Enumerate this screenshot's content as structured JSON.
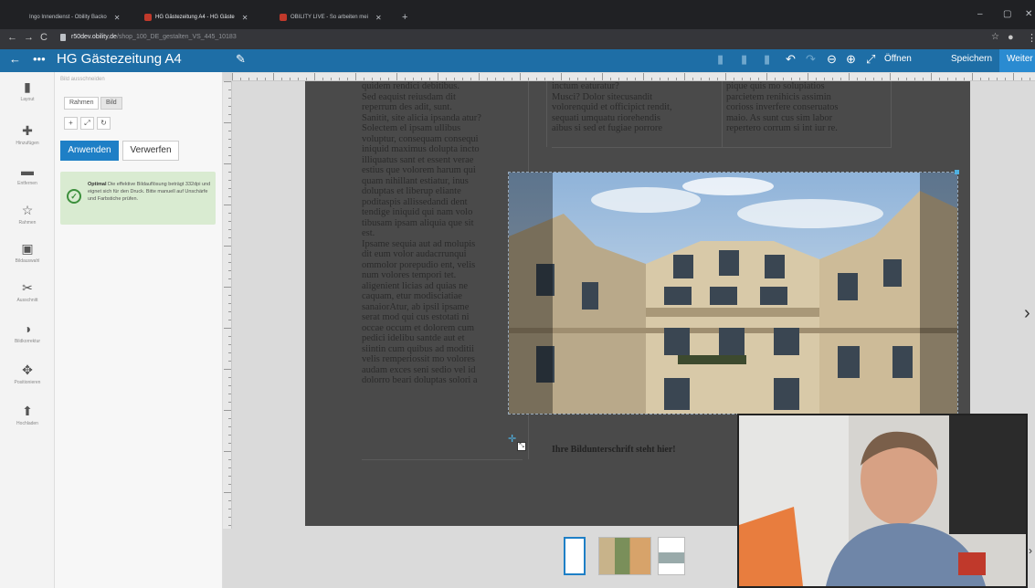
{
  "browser": {
    "tabs": [
      {
        "title": "Ingo Innendienst - Obility Backo",
        "active": false
      },
      {
        "title": "HG Gästezeitung A4 - HG Gäste",
        "active": true
      },
      {
        "title": "OBILITY LIVE - So arbeiten mei",
        "active": false
      }
    ],
    "url_host": "r50dev.obility.de",
    "url_path": "/shop_100_DE_gestalten_VS_445_10183"
  },
  "app": {
    "title": "HG Gästezeitung A4",
    "open_label": "Öffnen",
    "save_label": "Speichern",
    "next_label": "Weiter"
  },
  "tools": [
    {
      "label": "Layout",
      "icon": "file-icon",
      "glyph": "▮"
    },
    {
      "label": "Hinzufügen",
      "icon": "plus-icon",
      "glyph": "✚"
    },
    {
      "label": "Entfernen",
      "icon": "minus-icon",
      "glyph": "▬"
    },
    {
      "label": "Rahmen",
      "icon": "star-icon",
      "glyph": "☆"
    },
    {
      "label": "Bildauswahl",
      "icon": "image-icon",
      "glyph": "▣"
    },
    {
      "label": "Ausschnitt",
      "icon": "crop-icon",
      "glyph": "✂"
    },
    {
      "label": "Bildkorrektur",
      "icon": "contrast-icon",
      "glyph": "◑"
    },
    {
      "label": "Positionieren",
      "icon": "move-icon",
      "glyph": "✥"
    },
    {
      "label": "Hochladen",
      "icon": "upload-icon",
      "glyph": "⬆"
    }
  ],
  "panel": {
    "header": "Bild ausschneiden",
    "tab_frame": "Rahmen",
    "tab_image": "Bild",
    "btn_zoom_in": "+",
    "btn_fit": "⤢",
    "btn_reset": "↻",
    "apply_label": "Anwenden",
    "discard_label": "Verwerfen",
    "info_bold": "Optimal",
    "info_text": " Die effektive Bildauflösung beträgt 332dpi und eignet sich für den Druck. Bitte manuell auf Unschärfe und Farbstiche prüfen."
  },
  "document": {
    "col1_lines": [
      "quidem rendici debitibus.",
      "Sed eaquist reiusdam dit",
      "reperrum des adit, sunt.",
      "Sanitit, site alicia ipsanda atur?",
      "Solectem el ipsam ullibus",
      "voluptur, consequam consequi",
      "iniquid maximus dolupta incto",
      "illiquatus sant et essent verae",
      "estius que volorem harum qui",
      "quam nihillant estiatur, inus",
      "doluptas et liberup eliante",
      "poditaspis allissedandi dent",
      "tendige iniquid qui nam volo",
      "tibusam ipsam aliquia que sit",
      "est.",
      "Ipsame sequia aut ad molupis",
      "dit eum volor audacrrunqui",
      "ommolor porepudio ent, velis",
      "num volores tempori tet.",
      "aligenient licias ad quias ne",
      "caquam, etur modisciatiae",
      "sanaiorAtur, ab ipsil ipsame",
      "serat mod qui cus estotati ni",
      "occae occum et dolorem cum",
      "pedici idelibu santde aut et",
      "siintin cum quibus ad moditii",
      "velis remperiossit mo volores",
      "audam exces seni sedio vel id",
      "dolorro beari doluptas solori a"
    ],
    "col2_lines": [
      "inctum eaturatur?",
      "Musci? Dolor sitecusandit",
      "volorenquid et officipict rendit,",
      "sequati umquatu riorehendis",
      "aibus si sed et fugiae porrore"
    ],
    "col3_lines": [
      "pique quis mo solupiatios",
      "parcietem renihicis assimin",
      "corioss inverfere conseruatos",
      "maio. As sunt cus sim labor",
      "repertero corrum si int iur re."
    ],
    "caption": "Ihre Bildunterschrift steht hier!"
  },
  "colors": {
    "accent": "#1e7fc6",
    "toolbar": "#1e6ea6",
    "success": "#d9ebd1"
  }
}
